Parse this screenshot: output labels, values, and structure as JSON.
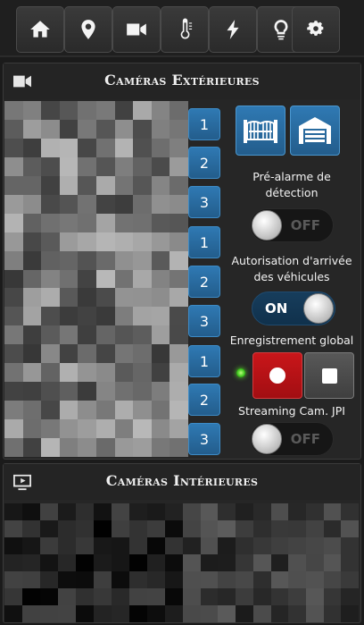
{
  "nav": {
    "buttons": [
      {
        "icon": "home-icon"
      },
      {
        "icon": "location-pin-icon"
      },
      {
        "icon": "video-camera-icon"
      },
      {
        "icon": "thermometer-icon"
      },
      {
        "icon": "lightning-bolt-icon"
      },
      {
        "icon": "lightbulb-icon"
      },
      {
        "icon": "gears-icon"
      }
    ]
  },
  "exterior": {
    "title": "Caméras Extérieures",
    "icon": "video-camera-icon",
    "camera_buttons": [
      "1",
      "2",
      "3",
      "1",
      "2",
      "3",
      "1",
      "2",
      "3"
    ],
    "gate_icon": "sliding-gate-icon",
    "garage_icon": "garage-door-icon",
    "pre_alarm": {
      "label": "Pré-alarme de détection",
      "state": "OFF"
    },
    "vehicle_auth": {
      "label": "Autorisation d'arrivée des véhicules",
      "state": "ON"
    },
    "recording": {
      "label": "Enregistrement global",
      "status_color": "#39c21b"
    },
    "streaming": {
      "label": "Streaming Cam. JPI",
      "state": "OFF"
    }
  },
  "interior": {
    "title": "Caméras Intérieures",
    "icon": "screen-play-icon"
  },
  "colors": {
    "accent_blue": "#2a6ea3",
    "record_red": "#b81216",
    "background": "#1b1b1b"
  }
}
